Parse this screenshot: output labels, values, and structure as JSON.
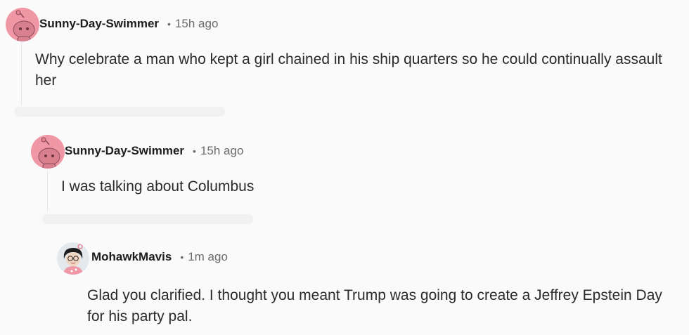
{
  "comments": [
    {
      "username": "Sunny-Day-Swimmer",
      "separator": "•",
      "time": "15h ago",
      "text": "Why celebrate a man who kept a girl chained in his ship quarters so he could continually assault her",
      "avatar_icon": "snoo-avatar-icon"
    },
    {
      "username": "Sunny-Day-Swimmer",
      "separator": "•",
      "time": "15h ago",
      "text": "I was talking about Columbus",
      "avatar_icon": "snoo-avatar-icon"
    },
    {
      "username": "MohawkMavis",
      "separator": "•",
      "time": "1m ago",
      "text": "Glad you clarified. I thought you meant Trump was going to create a Jeffrey Epstein Day for his party pal.",
      "avatar_icon": "cartoon-avatar-icon"
    }
  ],
  "colors": {
    "background": "#fafafa",
    "snoo_avatar_bg": "#ef97a4",
    "username": "#1c1c1c",
    "meta": "#6b6b6b"
  }
}
